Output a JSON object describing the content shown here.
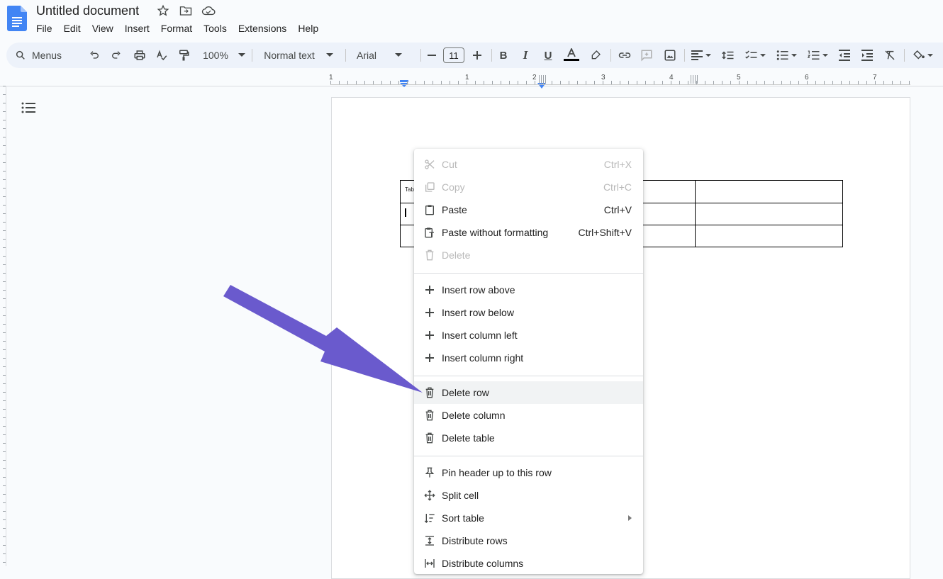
{
  "app": {
    "title": "Untitled document",
    "accent": "#4285f4"
  },
  "menubar": [
    "File",
    "Edit",
    "View",
    "Insert",
    "Format",
    "Tools",
    "Extensions",
    "Help"
  ],
  "toolbar": {
    "search_label": "Menus",
    "zoom": "100%",
    "style": "Normal text",
    "font": "Arial",
    "font_size": "11"
  },
  "ruler": {
    "numbers": [
      "1",
      "1",
      "2",
      "3",
      "4",
      "5",
      "6",
      "7"
    ]
  },
  "table": {
    "cell_text": "Tab"
  },
  "context_menu": {
    "items": [
      {
        "label": "Cut",
        "shortcut": "Ctrl+X",
        "icon": "scissors-icon",
        "disabled": true
      },
      {
        "label": "Copy",
        "shortcut": "Ctrl+C",
        "icon": "copy-icon",
        "disabled": true
      },
      {
        "label": "Paste",
        "shortcut": "Ctrl+V",
        "icon": "clipboard-icon",
        "disabled": false
      },
      {
        "label": "Paste without formatting",
        "shortcut": "Ctrl+Shift+V",
        "icon": "clipboard-text-icon",
        "disabled": false
      },
      {
        "label": "Delete",
        "shortcut": "",
        "icon": "trash-icon",
        "disabled": true
      },
      {
        "label": "Insert row above",
        "icon": "plus-icon"
      },
      {
        "label": "Insert row below",
        "icon": "plus-icon"
      },
      {
        "label": "Insert column left",
        "icon": "plus-icon"
      },
      {
        "label": "Insert column right",
        "icon": "plus-icon"
      },
      {
        "label": "Delete row",
        "icon": "trash-icon",
        "highlighted": true
      },
      {
        "label": "Delete column",
        "icon": "trash-icon"
      },
      {
        "label": "Delete table",
        "icon": "trash-icon"
      },
      {
        "label": "Pin header up to this row",
        "icon": "pin-icon"
      },
      {
        "label": "Split cell",
        "icon": "split-cell-icon"
      },
      {
        "label": "Sort table",
        "icon": "sort-icon",
        "submenu": true
      },
      {
        "label": "Distribute rows",
        "icon": "distribute-rows-icon"
      },
      {
        "label": "Distribute columns",
        "icon": "distribute-columns-icon"
      }
    ]
  },
  "annotation": {
    "arrow_color": "#6a5acd"
  }
}
